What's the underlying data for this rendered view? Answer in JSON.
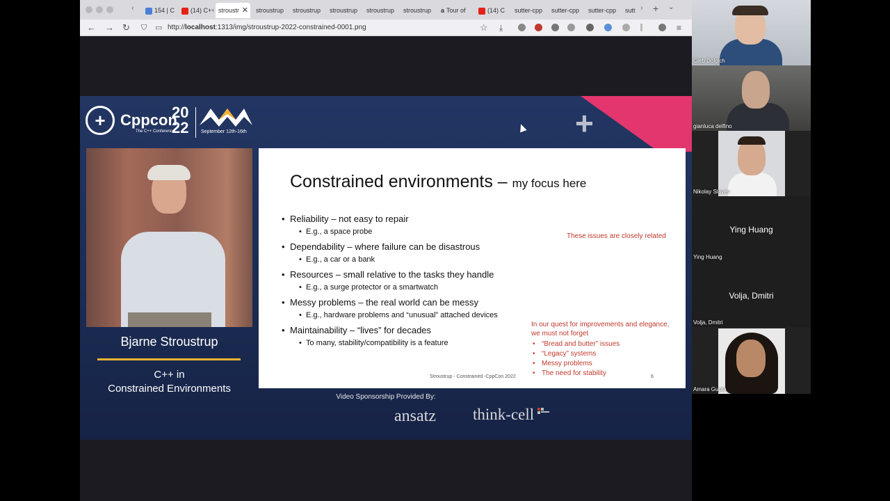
{
  "browser": {
    "tabs": [
      {
        "label": "154 | C",
        "icon": "page-icon",
        "color": "#4a7fd6"
      },
      {
        "label": "(14) C++",
        "icon": "youtube-icon",
        "color": "#e62117"
      },
      {
        "label": "stroustr",
        "icon": "none",
        "active": true
      },
      {
        "label": "stroustrup",
        "icon": "none"
      },
      {
        "label": "stroustrup",
        "icon": "none"
      },
      {
        "label": "stroustrup",
        "icon": "none"
      },
      {
        "label": "stroustrup",
        "icon": "none"
      },
      {
        "label": "stroustrup",
        "icon": "none"
      },
      {
        "label": "Tour of",
        "icon": "amazon-icon",
        "color": "#222"
      },
      {
        "label": "(14) C",
        "icon": "youtube-icon",
        "color": "#e62117"
      },
      {
        "label": "sutter-cpp",
        "icon": "none"
      },
      {
        "label": "sutter-cpp",
        "icon": "none"
      },
      {
        "label": "sutter-cpp",
        "icon": "none"
      },
      {
        "label": "sutt",
        "icon": "none"
      }
    ],
    "url_prefix": "http://",
    "url_host": "localhost",
    "url_rest": ":1313/img/stroustrup-2022-constrained-0001.png"
  },
  "conference": {
    "name": "Cppcon",
    "tagline": "The C++ Conference",
    "year_top": "20",
    "year_bottom": "22",
    "dates": "September 12th-16th",
    "accent_pink": "#e3366e",
    "accent_gold": "#f0b232"
  },
  "speaker": {
    "name": "Bjarne Stroustrup",
    "talk_line1": "C++ in",
    "talk_line2": "Constrained Environments"
  },
  "slide": {
    "title": "Constrained environments – ",
    "title_focus": "my focus here",
    "bullets": [
      {
        "main": "Reliability – not easy to repair",
        "sub": "E.g., a space probe"
      },
      {
        "main": "Dependability – where failure can be disastrous",
        "sub": "E.g., a car or a bank"
      },
      {
        "main": "Resources – small relative to the tasks they handle",
        "sub": "E.g., a surge protector or a smartwatch"
      },
      {
        "main": "Messy problems – the real world can be messy",
        "sub": "E.g., hardware problems and “unusual” attached devices"
      },
      {
        "main": "Maintainability – “lives” for decades",
        "sub": "To many, stability/compatibility is a feature"
      }
    ],
    "related_note": "These issues are closely related",
    "quest_line1": "In our quest for improvements and elegance,",
    "quest_line2": "we must not forget",
    "quest_items": [
      "“Bread and butter” issues",
      "“Legacy” systems",
      "Messy problems",
      "The need for stability"
    ],
    "footer": "Stroustrup - Constrained -CppCon 2022",
    "page_number": "6"
  },
  "sponsors": {
    "heading": "Video Sponsorship Provided By:",
    "sponsor1": "ansatz",
    "sponsor2": "think-cell"
  },
  "participants": [
    {
      "name": "Gleb Dolgich",
      "video": true
    },
    {
      "name": "gianluca delfino",
      "video": true
    },
    {
      "name": "Nikolay Slavev",
      "video": true
    },
    {
      "name": "Ying Huang",
      "video": false
    },
    {
      "name": "Volja, Dmitri",
      "video": false
    },
    {
      "name": "Amara Gupta",
      "video": true
    }
  ]
}
